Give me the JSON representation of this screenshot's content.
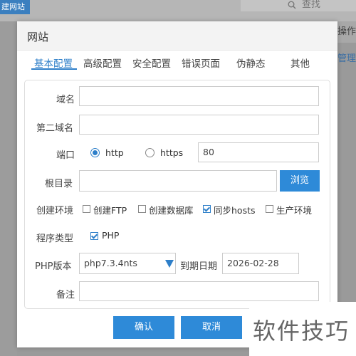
{
  "background": {
    "new_site_button": "建网站",
    "search_placeholder": "查找",
    "column_header": "操作",
    "manage_link": "管理"
  },
  "dialog": {
    "title": "网站",
    "tabs": [
      "基本配置",
      "高级配置",
      "安全配置",
      "错误页面",
      "伪静态",
      "其他"
    ],
    "active_tab": "基本配置",
    "form": {
      "domain_label": "域名",
      "domain_value": "",
      "second_domain_label": "第二域名",
      "second_domain_value": "",
      "port_label": "端口",
      "protocol_http": "http",
      "protocol_https": "https",
      "protocol_selected": "http",
      "port_value": "80",
      "root_label": "根目录",
      "root_value": "",
      "browse_button": "浏览",
      "env_label": "创建环境",
      "env_options": [
        {
          "label": "创建FTP",
          "checked": false
        },
        {
          "label": "创建数据库",
          "checked": false
        },
        {
          "label": "同步hosts",
          "checked": true
        },
        {
          "label": "生产环境",
          "checked": false
        }
      ],
      "program_type_label": "程序类型",
      "program_type_option": "PHP",
      "program_type_checked": true,
      "php_version_label": "PHP版本",
      "php_version_value": "php7.3.4nts",
      "expire_label": "到期日期",
      "expire_value": "2026-02-28",
      "note_label": "备注",
      "note_value": ""
    },
    "buttons": {
      "confirm": "确认",
      "cancel": "取消"
    }
  },
  "watermark": "软件技巧",
  "colors": {
    "accent": "#2e7fc9",
    "button": "#2e8ad8",
    "overlay": "#9a9a9a"
  }
}
